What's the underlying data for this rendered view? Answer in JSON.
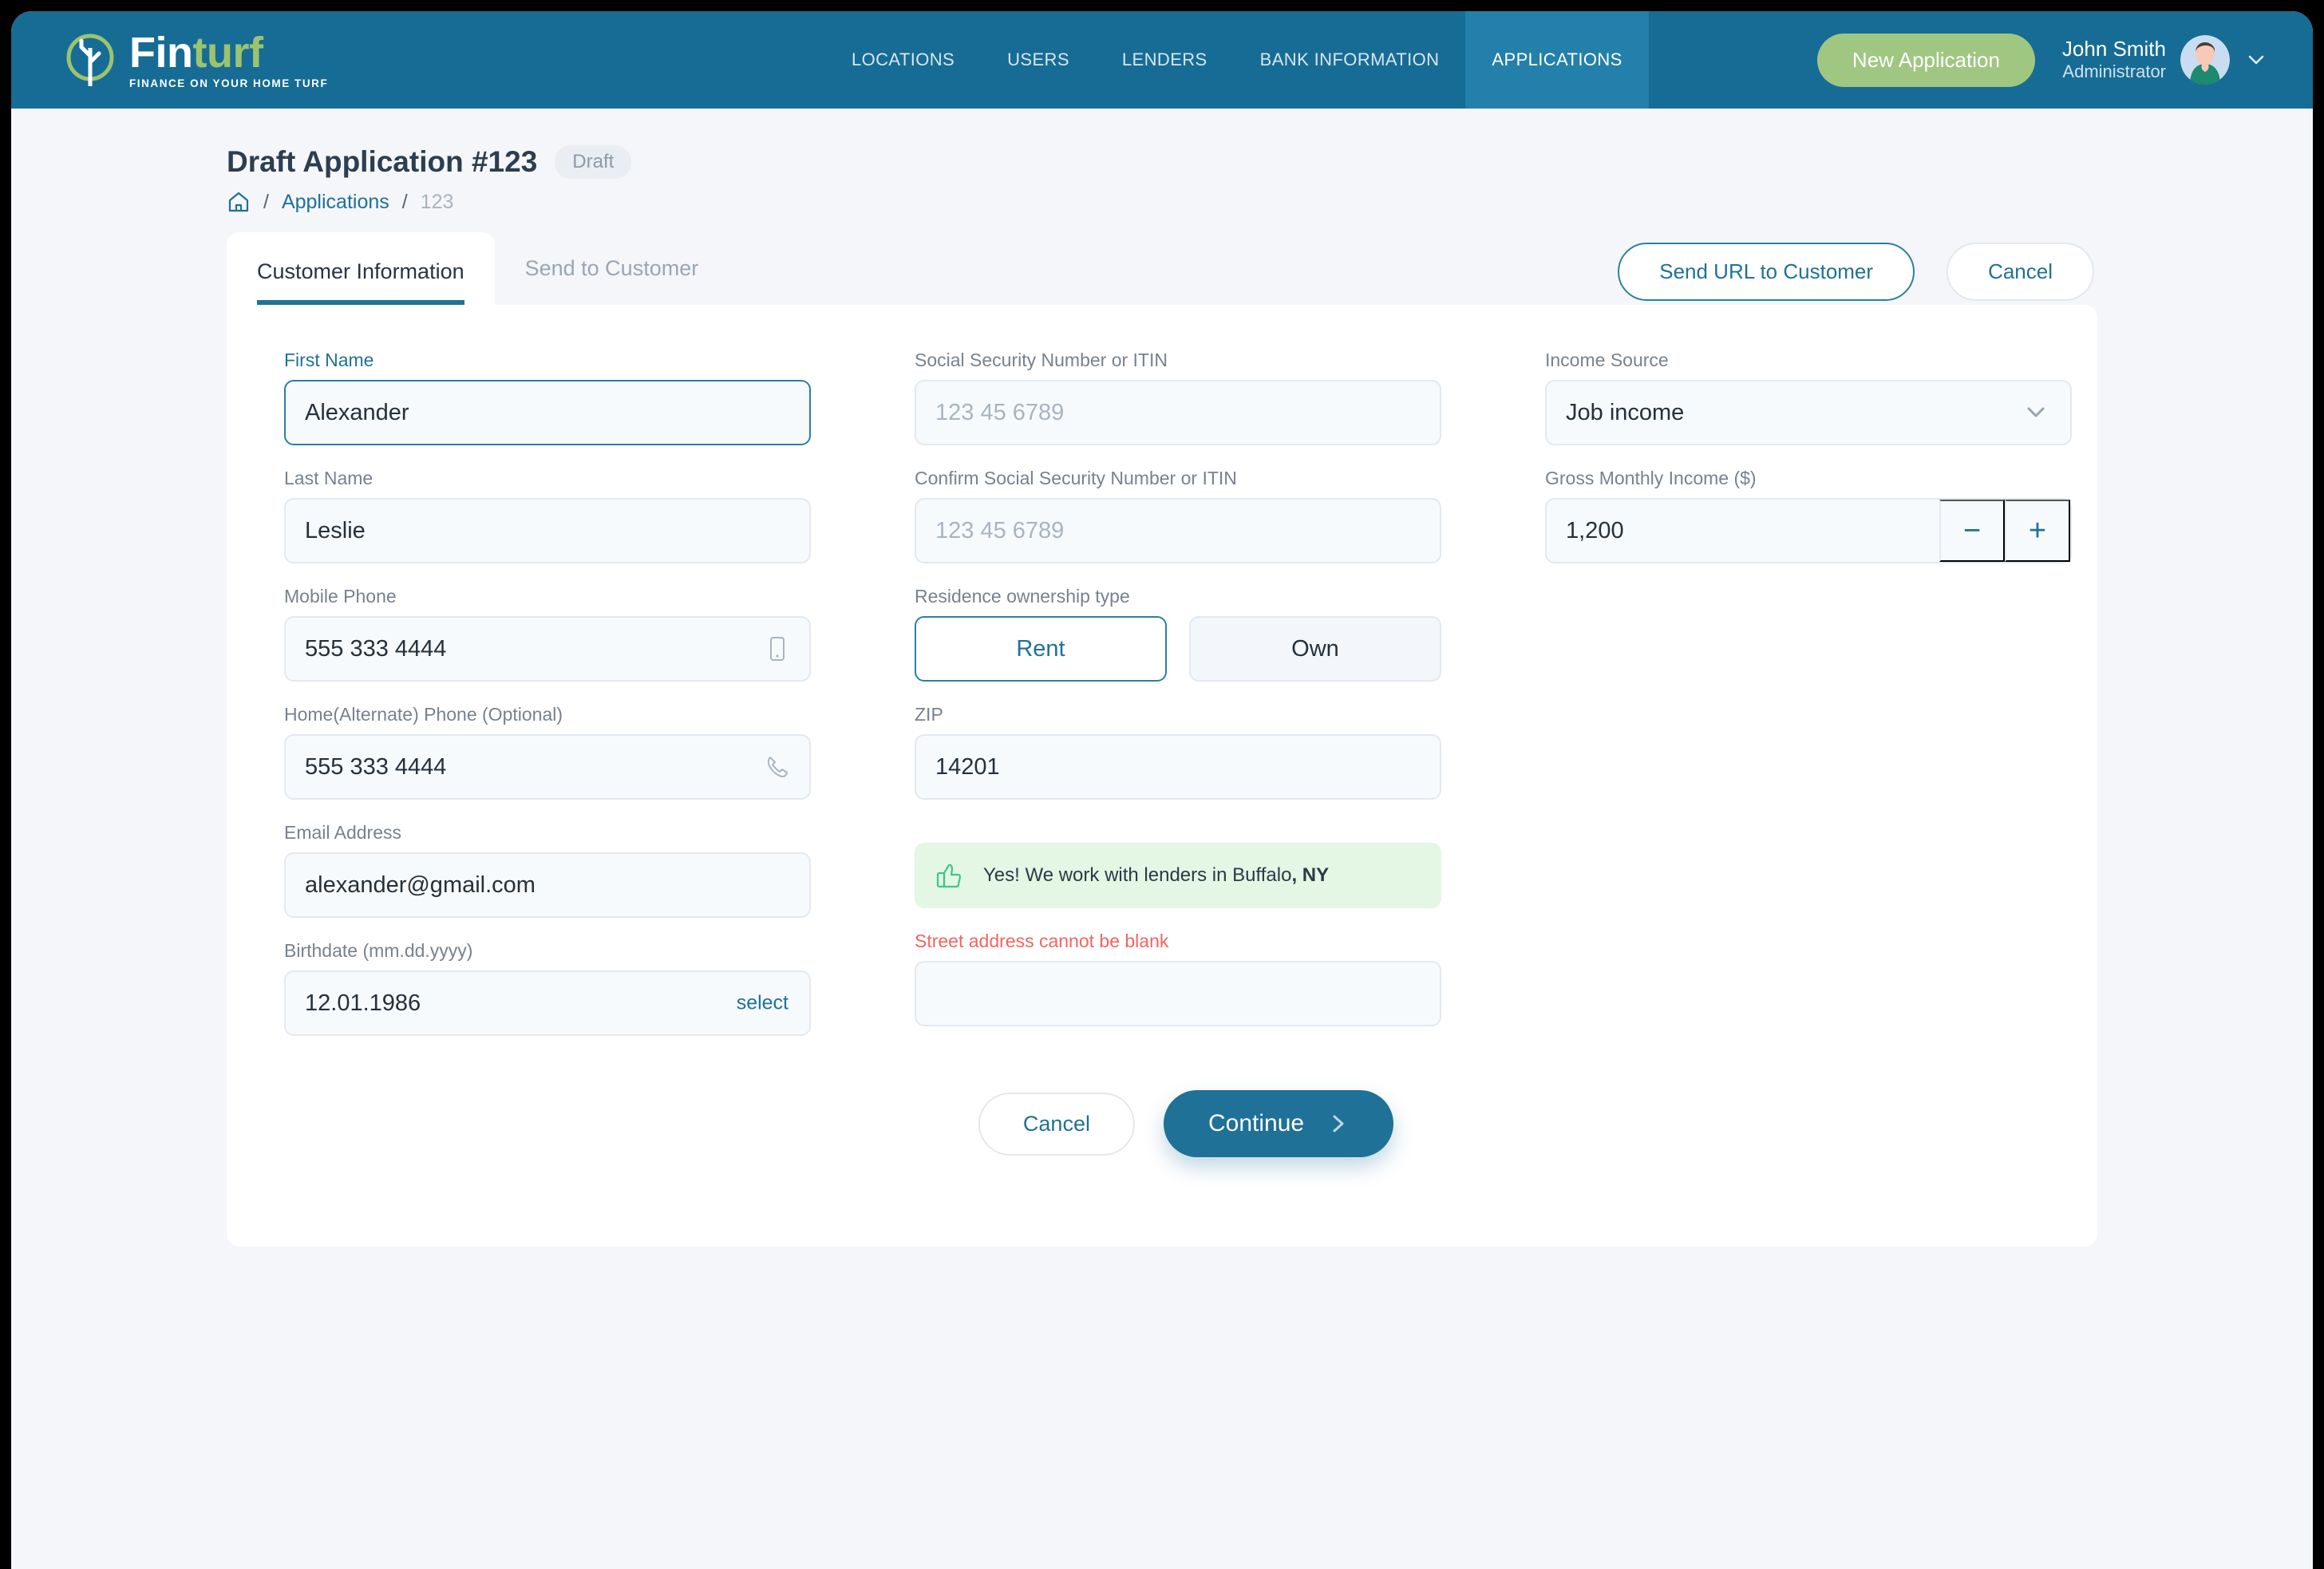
{
  "brand": {
    "name_part1": "Fin",
    "name_part2": "turf",
    "tagline": "FINANCE ON YOUR HOME TURF",
    "logo_icon": "tree-in-circle-icon",
    "header_bg": "#166C94",
    "accent_green": "#9CC46E",
    "accent_teal": "#1F7197"
  },
  "topnav": {
    "items": [
      {
        "label": "LOCATIONS",
        "active": false
      },
      {
        "label": "USERS",
        "active": false
      },
      {
        "label": "LENDERS",
        "active": false
      },
      {
        "label": "BANK INFORMATION",
        "active": false
      },
      {
        "label": "APPLICATIONS",
        "active": true
      }
    ],
    "new_application_label": "New Application",
    "user": {
      "name": "John Smith",
      "role": "Administrator"
    }
  },
  "page": {
    "title": "Draft Application #123",
    "status_badge": "Draft",
    "breadcrumb": {
      "home_icon": "home-icon",
      "sep": "/",
      "link_label": "Applications",
      "current_label": "123"
    },
    "actions": {
      "send_url_label": "Send URL to Customer",
      "cancel_label": "Cancel"
    }
  },
  "tabs": [
    {
      "label": "Customer Information",
      "active": true
    },
    {
      "label": "Send to Customer",
      "active": false
    }
  ],
  "form": {
    "col1": {
      "first_name": {
        "label": "First Name",
        "value": "Alexander",
        "placeholder": "",
        "focused": true
      },
      "last_name": {
        "label": "Last Name",
        "value": "Leslie",
        "placeholder": ""
      },
      "mobile_phone": {
        "label": "Mobile Phone",
        "value": "555 333 4444",
        "placeholder": "",
        "icon": "mobile-phone-icon"
      },
      "home_phone": {
        "label": "Home(Alternate) Phone (Optional)",
        "value": "555 333 4444",
        "placeholder": "",
        "icon": "telephone-icon"
      },
      "email": {
        "label": "Email Address",
        "value": "alexander@gmail.com",
        "placeholder": ""
      },
      "birthdate": {
        "label": "Birthdate (mm.dd.yyyy)",
        "value": "12.01.1986",
        "placeholder": "",
        "action_label": "select"
      }
    },
    "col2": {
      "ssn": {
        "label": "Social Security Number or ITIN",
        "value": "",
        "placeholder": "123 45 6789"
      },
      "ssn_confirm": {
        "label": "Confirm Social Security Number or ITIN",
        "value": "",
        "placeholder": "123 45 6789"
      },
      "residence": {
        "label": "Residence ownership type",
        "options": [
          {
            "label": "Rent",
            "selected": true
          },
          {
            "label": "Own",
            "selected": false
          }
        ]
      },
      "zip": {
        "label": "ZIP",
        "value": "14201",
        "placeholder": ""
      },
      "success_banner": {
        "icon": "thumbs-up-icon",
        "text_prefix": "Yes! We work with lenders in Buffalo",
        "text_emphasis": ", NY",
        "bg_color": "#E4F6E4"
      },
      "street_address": {
        "label": "Street address cannot be blank",
        "value": "",
        "placeholder": "",
        "error": true,
        "error_color": "#F4645F"
      }
    },
    "col3": {
      "income_source": {
        "label": "Income Source",
        "value": "Job income",
        "placeholder": "",
        "icon": "chevron-down-icon"
      },
      "gross_income": {
        "label": "Gross Monthly Income ($)",
        "value": "1,200",
        "placeholder": "",
        "decrement_label": "−",
        "increment_label": "+"
      }
    },
    "actions": {
      "cancel_label": "Cancel",
      "continue_label": "Continue",
      "continue_icon": "chevron-right-icon"
    }
  }
}
